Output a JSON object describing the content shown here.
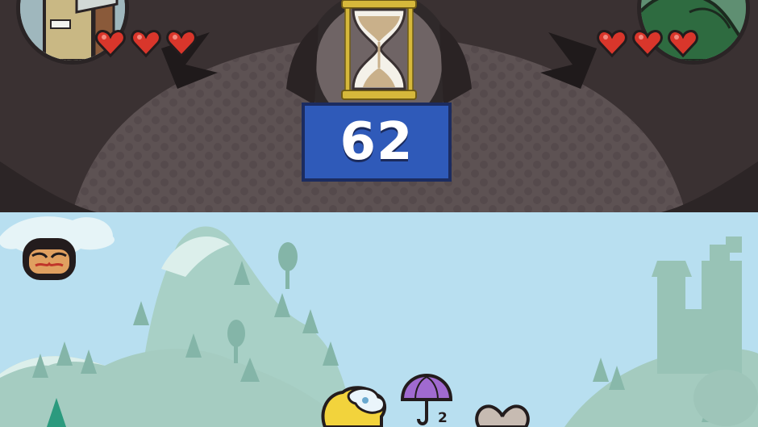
{
  "timer": {
    "value": "62"
  },
  "player_left": {
    "lives": 3,
    "heart_color": "#d9362b"
  },
  "player_right": {
    "lives": 3,
    "heart_color": "#d9362b"
  },
  "colors": {
    "sky": "#b8dff0",
    "hill": "#a9cfc4",
    "timer_box": "#2f5ab9",
    "top_bg": "#3c3233"
  },
  "items": [
    "umbrella-icon",
    "heart-icon",
    "cloud-character-icon",
    "bandit-face-icon"
  ],
  "umbrella_count": "2"
}
